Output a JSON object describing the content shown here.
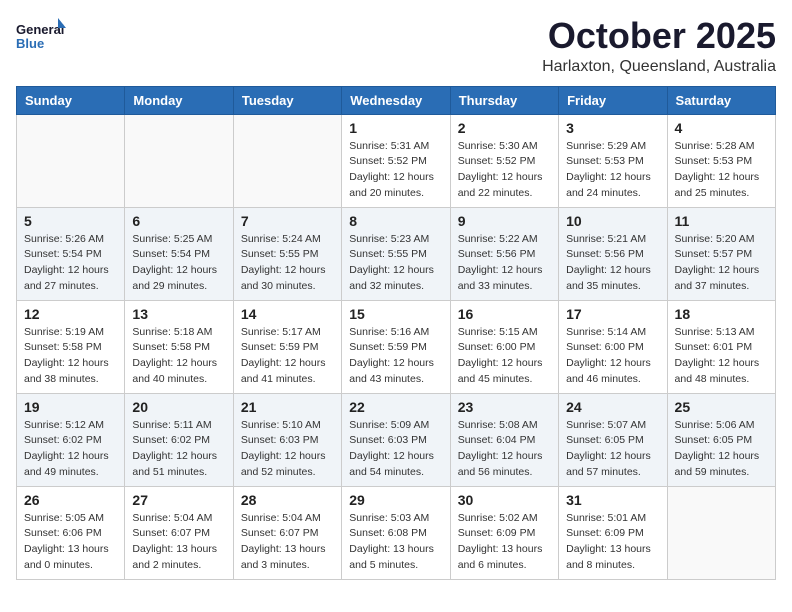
{
  "header": {
    "logo_line1": "General",
    "logo_line2": "Blue",
    "month": "October 2025",
    "location": "Harlaxton, Queensland, Australia"
  },
  "weekdays": [
    "Sunday",
    "Monday",
    "Tuesday",
    "Wednesday",
    "Thursday",
    "Friday",
    "Saturday"
  ],
  "weeks": [
    [
      {
        "day": "",
        "info": ""
      },
      {
        "day": "",
        "info": ""
      },
      {
        "day": "",
        "info": ""
      },
      {
        "day": "1",
        "info": "Sunrise: 5:31 AM\nSunset: 5:52 PM\nDaylight: 12 hours\nand 20 minutes."
      },
      {
        "day": "2",
        "info": "Sunrise: 5:30 AM\nSunset: 5:52 PM\nDaylight: 12 hours\nand 22 minutes."
      },
      {
        "day": "3",
        "info": "Sunrise: 5:29 AM\nSunset: 5:53 PM\nDaylight: 12 hours\nand 24 minutes."
      },
      {
        "day": "4",
        "info": "Sunrise: 5:28 AM\nSunset: 5:53 PM\nDaylight: 12 hours\nand 25 minutes."
      }
    ],
    [
      {
        "day": "5",
        "info": "Sunrise: 5:26 AM\nSunset: 5:54 PM\nDaylight: 12 hours\nand 27 minutes."
      },
      {
        "day": "6",
        "info": "Sunrise: 5:25 AM\nSunset: 5:54 PM\nDaylight: 12 hours\nand 29 minutes."
      },
      {
        "day": "7",
        "info": "Sunrise: 5:24 AM\nSunset: 5:55 PM\nDaylight: 12 hours\nand 30 minutes."
      },
      {
        "day": "8",
        "info": "Sunrise: 5:23 AM\nSunset: 5:55 PM\nDaylight: 12 hours\nand 32 minutes."
      },
      {
        "day": "9",
        "info": "Sunrise: 5:22 AM\nSunset: 5:56 PM\nDaylight: 12 hours\nand 33 minutes."
      },
      {
        "day": "10",
        "info": "Sunrise: 5:21 AM\nSunset: 5:56 PM\nDaylight: 12 hours\nand 35 minutes."
      },
      {
        "day": "11",
        "info": "Sunrise: 5:20 AM\nSunset: 5:57 PM\nDaylight: 12 hours\nand 37 minutes."
      }
    ],
    [
      {
        "day": "12",
        "info": "Sunrise: 5:19 AM\nSunset: 5:58 PM\nDaylight: 12 hours\nand 38 minutes."
      },
      {
        "day": "13",
        "info": "Sunrise: 5:18 AM\nSunset: 5:58 PM\nDaylight: 12 hours\nand 40 minutes."
      },
      {
        "day": "14",
        "info": "Sunrise: 5:17 AM\nSunset: 5:59 PM\nDaylight: 12 hours\nand 41 minutes."
      },
      {
        "day": "15",
        "info": "Sunrise: 5:16 AM\nSunset: 5:59 PM\nDaylight: 12 hours\nand 43 minutes."
      },
      {
        "day": "16",
        "info": "Sunrise: 5:15 AM\nSunset: 6:00 PM\nDaylight: 12 hours\nand 45 minutes."
      },
      {
        "day": "17",
        "info": "Sunrise: 5:14 AM\nSunset: 6:00 PM\nDaylight: 12 hours\nand 46 minutes."
      },
      {
        "day": "18",
        "info": "Sunrise: 5:13 AM\nSunset: 6:01 PM\nDaylight: 12 hours\nand 48 minutes."
      }
    ],
    [
      {
        "day": "19",
        "info": "Sunrise: 5:12 AM\nSunset: 6:02 PM\nDaylight: 12 hours\nand 49 minutes."
      },
      {
        "day": "20",
        "info": "Sunrise: 5:11 AM\nSunset: 6:02 PM\nDaylight: 12 hours\nand 51 minutes."
      },
      {
        "day": "21",
        "info": "Sunrise: 5:10 AM\nSunset: 6:03 PM\nDaylight: 12 hours\nand 52 minutes."
      },
      {
        "day": "22",
        "info": "Sunrise: 5:09 AM\nSunset: 6:03 PM\nDaylight: 12 hours\nand 54 minutes."
      },
      {
        "day": "23",
        "info": "Sunrise: 5:08 AM\nSunset: 6:04 PM\nDaylight: 12 hours\nand 56 minutes."
      },
      {
        "day": "24",
        "info": "Sunrise: 5:07 AM\nSunset: 6:05 PM\nDaylight: 12 hours\nand 57 minutes."
      },
      {
        "day": "25",
        "info": "Sunrise: 5:06 AM\nSunset: 6:05 PM\nDaylight: 12 hours\nand 59 minutes."
      }
    ],
    [
      {
        "day": "26",
        "info": "Sunrise: 5:05 AM\nSunset: 6:06 PM\nDaylight: 13 hours\nand 0 minutes."
      },
      {
        "day": "27",
        "info": "Sunrise: 5:04 AM\nSunset: 6:07 PM\nDaylight: 13 hours\nand 2 minutes."
      },
      {
        "day": "28",
        "info": "Sunrise: 5:04 AM\nSunset: 6:07 PM\nDaylight: 13 hours\nand 3 minutes."
      },
      {
        "day": "29",
        "info": "Sunrise: 5:03 AM\nSunset: 6:08 PM\nDaylight: 13 hours\nand 5 minutes."
      },
      {
        "day": "30",
        "info": "Sunrise: 5:02 AM\nSunset: 6:09 PM\nDaylight: 13 hours\nand 6 minutes."
      },
      {
        "day": "31",
        "info": "Sunrise: 5:01 AM\nSunset: 6:09 PM\nDaylight: 13 hours\nand 8 minutes."
      },
      {
        "day": "",
        "info": ""
      }
    ]
  ]
}
